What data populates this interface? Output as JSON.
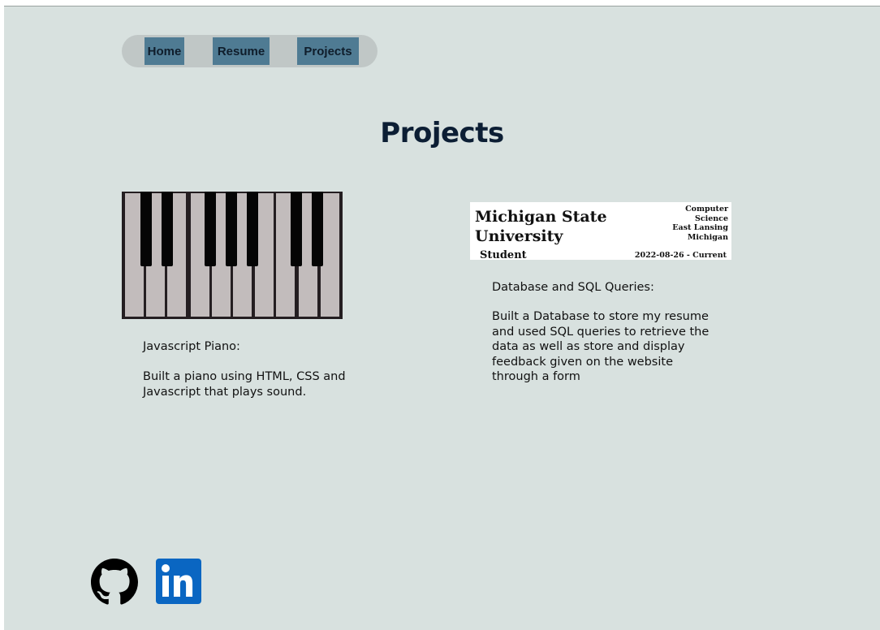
{
  "nav": {
    "items": [
      {
        "label": "Home"
      },
      {
        "label": "Resume"
      },
      {
        "label": "Projects"
      }
    ]
  },
  "page": {
    "title": "Projects"
  },
  "projects": [
    {
      "image_icon": "piano-keyboard-image",
      "name": "Javascript Piano:",
      "description": "Built a piano using HTML, CSS and Javascript that plays sound."
    },
    {
      "image_icon": "resume-database-screenshot",
      "image_text": {
        "school_line1": "Michigan State",
        "school_line2": "University",
        "location_lines": [
          "Computer",
          "Science",
          "East Lansing",
          "Michigan"
        ],
        "role": "Student",
        "dates": "2022-08-26 - Current"
      },
      "name": "Database and SQL Queries:",
      "description": "Built a Database to store my resume and used SQL queries to retrieve the data as well as store and display feedback given on the website through a form"
    }
  ],
  "footer": {
    "icons": [
      "github-icon",
      "linkedin-icon"
    ],
    "linkedin_text": "in"
  },
  "colors": {
    "page_background": "#d8e1df",
    "nav_pill": "#c0c7c6",
    "nav_button": "#4f7b93",
    "title_text": "#0c1e34",
    "linkedin_brand": "#0a66c2"
  }
}
